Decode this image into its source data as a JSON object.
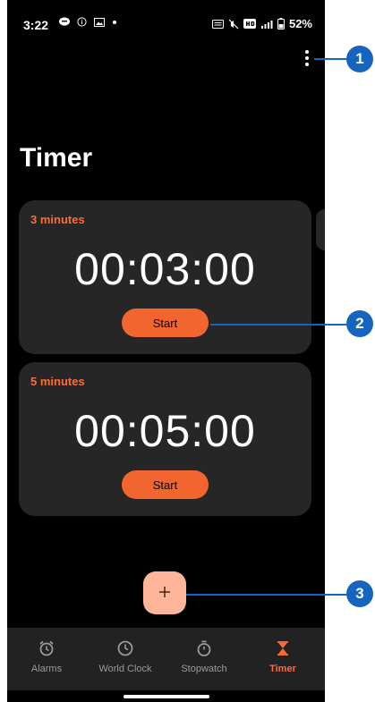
{
  "status_bar": {
    "time": "3:22",
    "battery_percent": "52%"
  },
  "header": {
    "title": "Timer"
  },
  "timers": [
    {
      "label": "3 minutes",
      "time": "00:03:00",
      "start_label": "Start"
    },
    {
      "label": "5 minutes",
      "time": "00:05:00",
      "start_label": "Start"
    }
  ],
  "fab": {
    "icon": "plus-icon",
    "label": "+"
  },
  "bottom_nav": [
    {
      "label": "Alarms",
      "icon": "alarm-clock-icon",
      "active": false
    },
    {
      "label": "World Clock",
      "icon": "clock-icon",
      "active": false
    },
    {
      "label": "Stopwatch",
      "icon": "stopwatch-icon",
      "active": false
    },
    {
      "label": "Timer",
      "icon": "hourglass-icon",
      "active": true
    }
  ],
  "callouts": [
    "1",
    "2",
    "3"
  ],
  "colors": {
    "accent": "#ff6b35",
    "start_button": "#f2652e",
    "fab": "#ffb59a",
    "card_bg": "#262626",
    "callout": "#1565c0"
  }
}
